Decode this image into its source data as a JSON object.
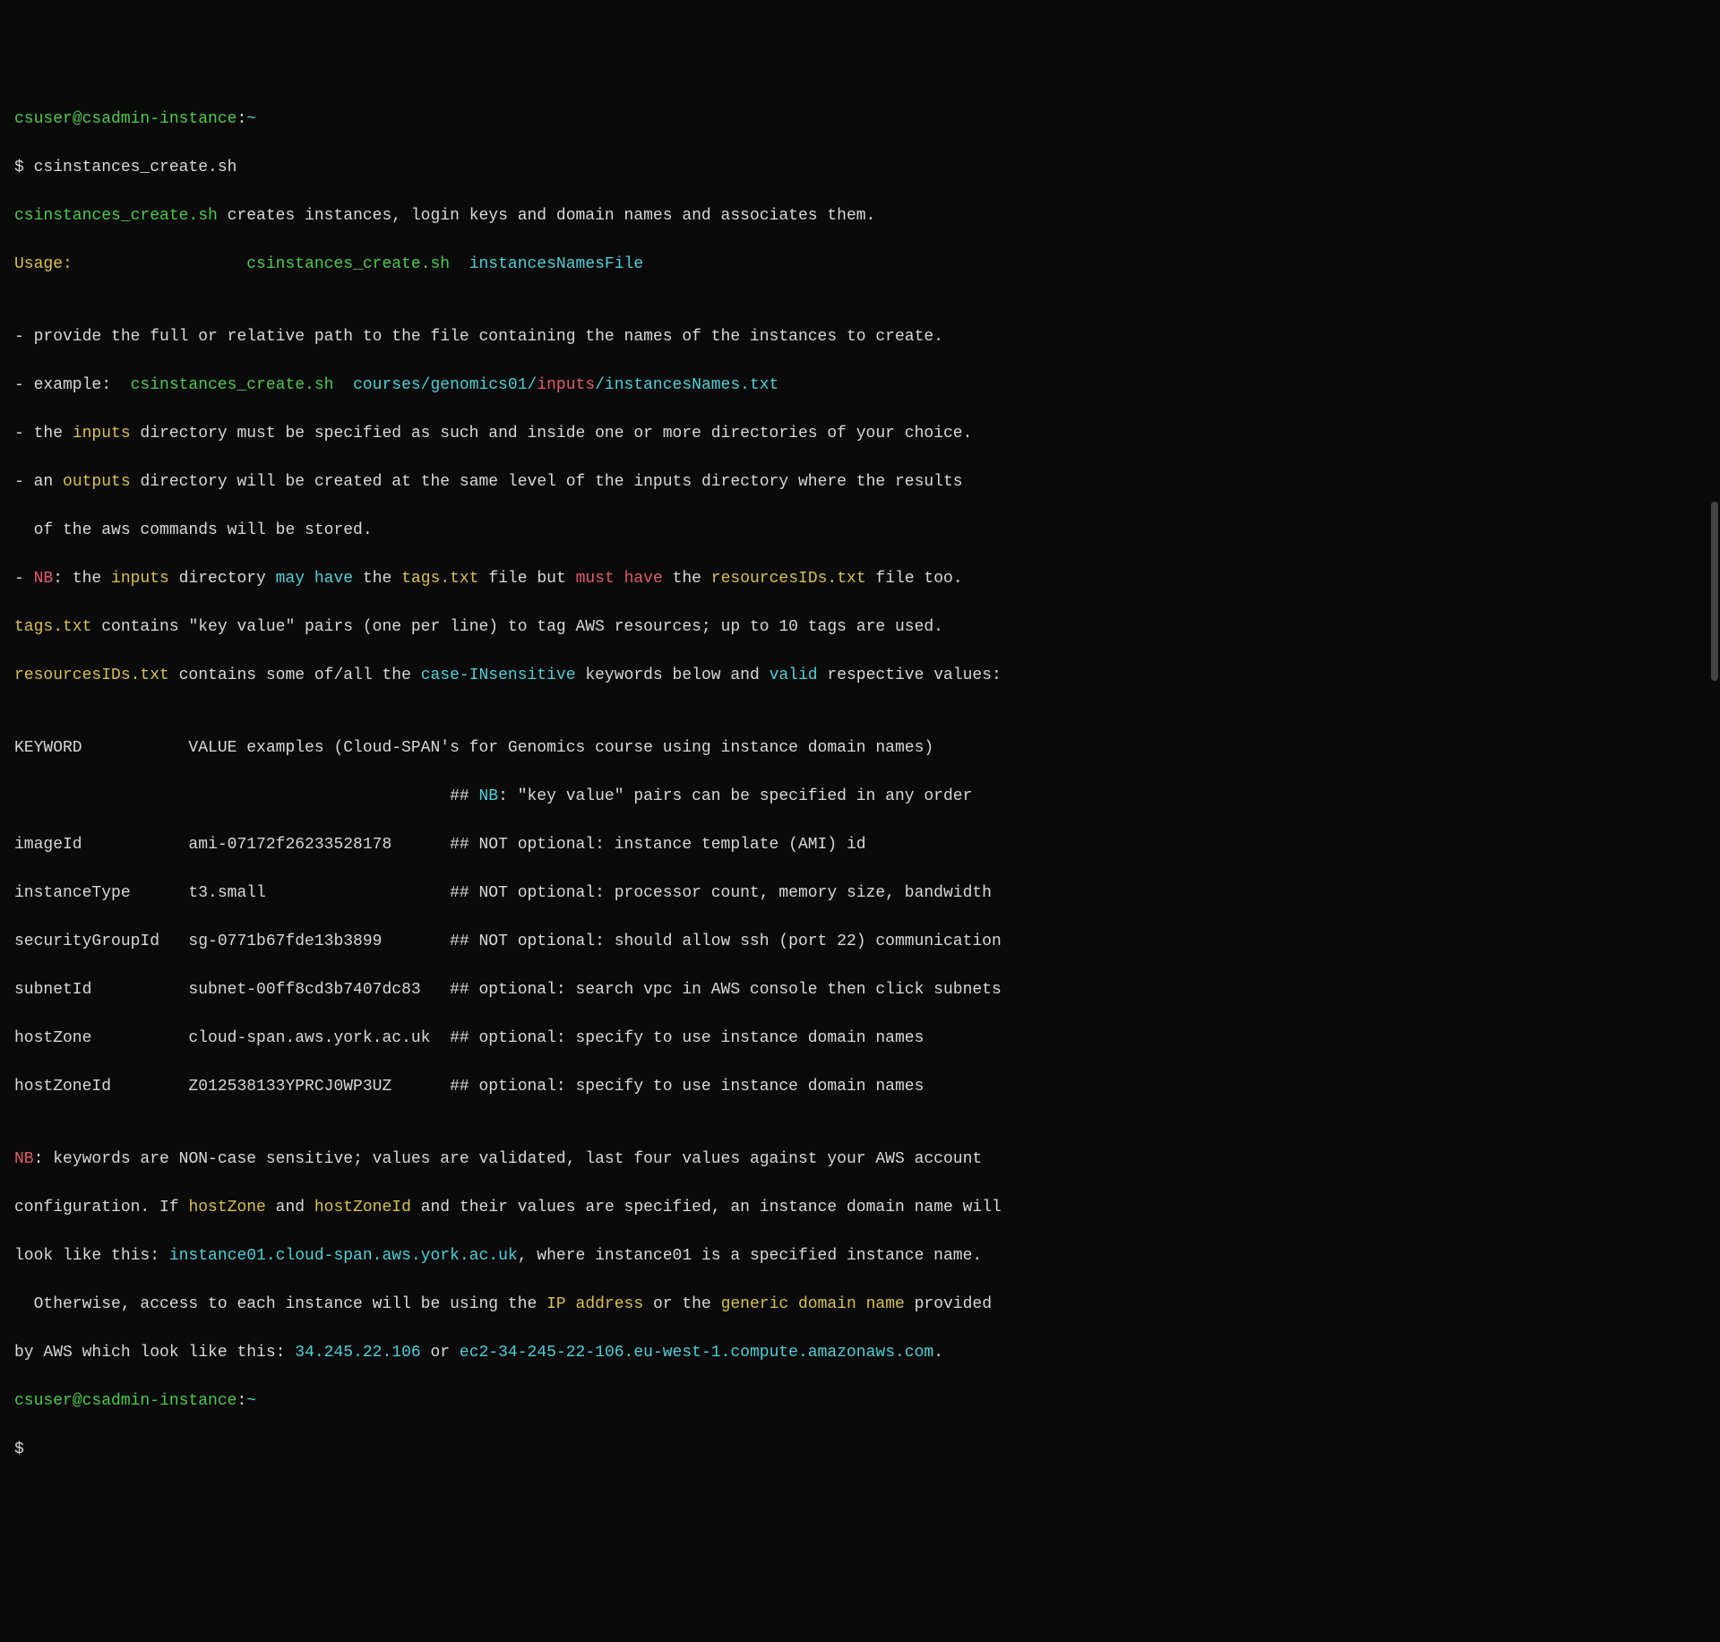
{
  "prompt1": {
    "user": "csuser",
    "at": "@",
    "host": "csadmin-instance",
    "colon": ":",
    "path": "~",
    "dollar": "$ ",
    "cmd": "csinstances_create.sh"
  },
  "line_desc": {
    "script": "csinstances_create.sh",
    "rest": " creates instances, login keys and domain names and associates them."
  },
  "usage": {
    "label": "Usage:",
    "pad": "                  ",
    "script": "csinstances_create.sh",
    "arg": "  instancesNamesFile"
  },
  "blank": "",
  "b1": "- provide the full or relative path to the file containing the names of the instances to create.",
  "b2": {
    "pre": "- example:  ",
    "script": "csinstances_create.sh",
    "mid": "  courses/genomics01/",
    "inputs": "inputs",
    "post": "/instancesNames.txt"
  },
  "b3": {
    "pre": "- the ",
    "inputs": "inputs",
    "post": " directory must be specified as such and inside one or more directories of your choice."
  },
  "b4": {
    "pre": "- an ",
    "outputs": "outputs",
    "post": " directory will be created at the same level of the inputs directory where the results"
  },
  "b4b": "  of the aws commands will be stored.",
  "b5": {
    "pre": "- ",
    "nb": "NB",
    "pre2": ": the ",
    "inputs": "inputs",
    "mid1": " directory ",
    "may": "may have",
    "mid2": " the ",
    "tags": "tags.txt",
    "mid3": " file but ",
    "must": "must have",
    "mid4": " the ",
    "res": "resourcesIDs.txt",
    "post": " file too."
  },
  "tags_line": {
    "tags": "tags.txt",
    "post": " contains \"key value\" pairs (one per line) to tag AWS resources; up to 10 tags are used."
  },
  "res_line": {
    "res": "resourcesIDs.txt",
    "mid1": " contains some of/all the ",
    "ci": "case-INsensitive",
    "mid2": " keywords below and ",
    "valid": "valid",
    "post": " respective values:"
  },
  "hdr": "KEYWORD           VALUE examples (Cloud-SPAN's for Genomics course using instance domain names)",
  "nbline": {
    "pad": "                                             ## ",
    "nb": "NB",
    "post": ": \"key value\" pairs can be specified in any order"
  },
  "rows": {
    "r1": "imageId           ami-07172f26233528178      ## NOT optional: instance template (AMI) id",
    "r2": "instanceType      t3.small                   ## NOT optional: processor count, memory size, bandwidth",
    "r3": "securityGroupId   sg-0771b67fde13b3899       ## NOT optional: should allow ssh (port 22) communication",
    "r4": "subnetId          subnet-00ff8cd3b7407dc83   ## optional: search vpc in AWS console then click subnets",
    "r5": "hostZone          cloud-span.aws.york.ac.uk  ## optional: specify to use instance domain names",
    "r6": "hostZoneId        Z012538133YPRCJ0WP3UZ      ## optional: specify to use instance domain names"
  },
  "nb2": {
    "nb": "NB",
    "l1": ": keywords are NON-case sensitive; values are validated, last four values against your AWS account"
  },
  "cfg": {
    "pre": "configuration. If ",
    "hz": "hostZone",
    "and": " and ",
    "hzi": "hostZoneId",
    "post": " and their values are specified, an instance domain name will"
  },
  "look": {
    "pre": "look like this: ",
    "dom": "instance01.cloud-span.aws.york.ac.uk",
    "post": ", where instance01 is a specified instance name."
  },
  "otherwise": {
    "pre": "  Otherwise, access to each instance will be using the ",
    "ip": "IP address",
    "or": " or the ",
    "gdn": "generic domain name",
    "post": " provided"
  },
  "byaws": {
    "pre": "by AWS which look like this: ",
    "ip": "34.245.22.106",
    "or": " or ",
    "dom": "ec2-34-245-22-106.eu-west-1.compute.amazonaws.com",
    "dot": "."
  },
  "prompt2": {
    "user": "csuser",
    "at": "@",
    "host": "csadmin-instance",
    "colon": ":",
    "path": "~",
    "dollar": "$"
  }
}
